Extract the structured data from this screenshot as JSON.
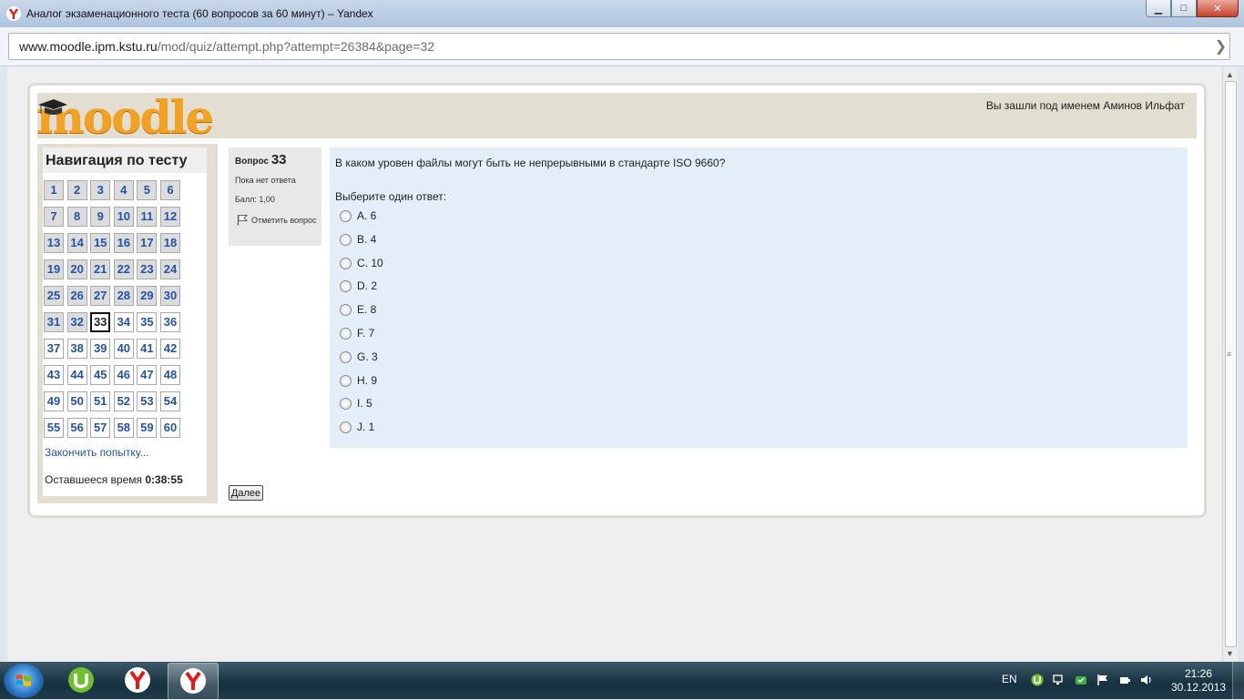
{
  "window": {
    "title": "Аналог экзаменационного теста (60 вопросов за 60 минут) – Yandex",
    "buttons": {
      "minimize": "▁",
      "maximize": "□",
      "close": "✕"
    }
  },
  "address_bar": {
    "host": "www.moodle.ipm.kstu.ru",
    "path": "/mod/quiz/attempt.php?attempt=26384&page=32"
  },
  "header": {
    "logo_text": "moodle",
    "login_info": "Вы зашли под именем Аминов Ильфат"
  },
  "quiz_nav": {
    "title": "Навигация по тесту",
    "current": 33,
    "answered_through": 32,
    "questions": [
      "1",
      "2",
      "3",
      "4",
      "5",
      "6",
      "7",
      "8",
      "9",
      "10",
      "11",
      "12",
      "13",
      "14",
      "15",
      "16",
      "17",
      "18",
      "19",
      "20",
      "21",
      "22",
      "23",
      "24",
      "25",
      "26",
      "27",
      "28",
      "29",
      "30",
      "31",
      "32",
      "33",
      "34",
      "35",
      "36",
      "37",
      "38",
      "39",
      "40",
      "41",
      "42",
      "43",
      "44",
      "45",
      "46",
      "47",
      "48",
      "49",
      "50",
      "51",
      "52",
      "53",
      "54",
      "55",
      "56",
      "57",
      "58",
      "59",
      "60"
    ],
    "finish_link": "Закончить попытку...",
    "timer_label": "Оставшееся время",
    "timer_value": "0:38:55"
  },
  "question_info": {
    "label": "Вопрос",
    "number": "33",
    "state": "Пока нет ответа",
    "grade": "Балл: 1,00",
    "flag_label": "Отметить вопрос"
  },
  "question": {
    "text": "В каком уровен файлы могут быть не непрерывными в стандарте ISO 9660?",
    "prompt": "Выберите один ответ:",
    "answers": [
      "A. 6",
      "B. 4",
      "C. 10",
      "D. 2",
      "E. 8",
      "F. 7",
      "G. 3",
      "H. 9",
      "I. 5",
      "J. 1"
    ]
  },
  "next_button": "Далее",
  "taskbar": {
    "lang": "EN",
    "time": "21:26",
    "date": "30.12.2013"
  },
  "colors": {
    "moodle_orange": "#f3a121",
    "link_blue": "#2452a6",
    "question_bg": "#e3eef8",
    "header_band": "#e2ded2"
  }
}
